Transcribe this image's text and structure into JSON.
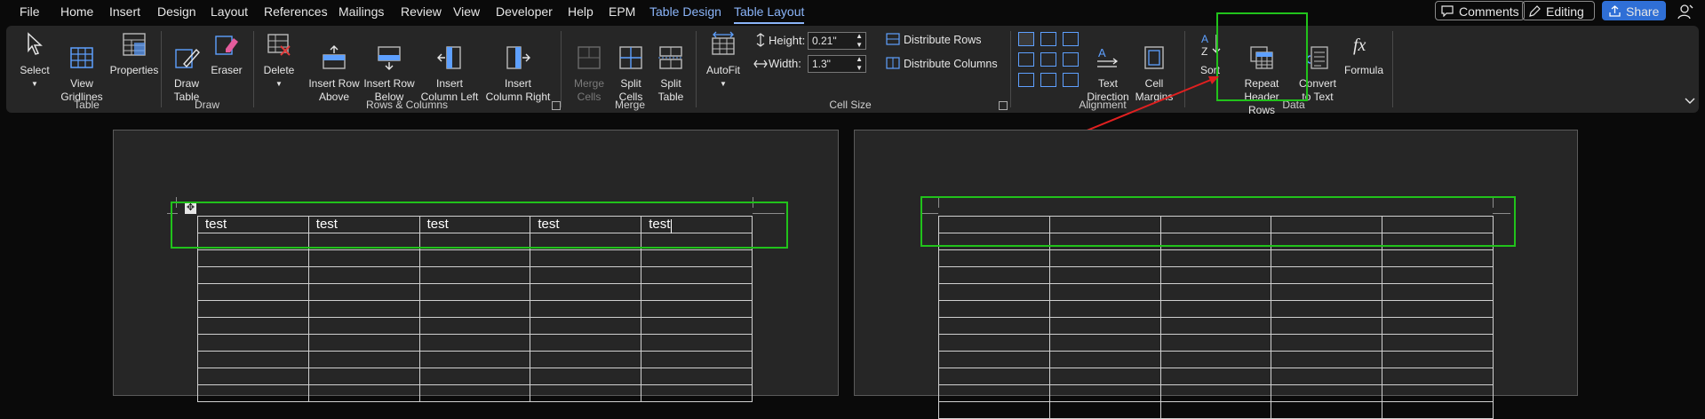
{
  "menu": {
    "tabs": [
      "File",
      "Home",
      "Insert",
      "Design",
      "Layout",
      "References",
      "Mailings",
      "Review",
      "View",
      "Developer",
      "Help",
      "EPM",
      "Table Design",
      "Table Layout"
    ],
    "comments": "Comments",
    "editing": "Editing",
    "share": "Share"
  },
  "ribbon": {
    "table": {
      "select": "Select",
      "view_gridlines": "View\nGridlines",
      "properties": "Properties",
      "group": "Table"
    },
    "draw": {
      "draw_table": "Draw\nTable",
      "eraser": "Eraser",
      "group": "Draw"
    },
    "rows_columns": {
      "delete": "Delete",
      "insert_above": "Insert Row\nAbove",
      "insert_below": "Insert Row\nBelow",
      "insert_left": "Insert\nColumn Left",
      "insert_right": "Insert\nColumn Right",
      "group": "Rows & Columns"
    },
    "merge": {
      "merge_cells": "Merge\nCells",
      "split_cells": "Split\nCells",
      "split_table": "Split\nTable",
      "group": "Merge"
    },
    "cell_size": {
      "autofit": "AutoFit",
      "height_label": "Height:",
      "height_value": "0.21\"",
      "width_label": "Width:",
      "width_value": "1.3\"",
      "distribute_rows": "Distribute Rows",
      "distribute_columns": "Distribute Columns",
      "group": "Cell Size"
    },
    "alignment": {
      "text_direction": "Text\nDirection",
      "cell_margins": "Cell\nMargins",
      "group": "Alignment"
    },
    "data": {
      "sort": "Sort",
      "repeat_header_rows": "Repeat\nHeader Rows",
      "convert_to_text": "Convert\nto Text",
      "formula": "Formula",
      "group": "Data"
    }
  },
  "document": {
    "header_cells": [
      "test",
      "test",
      "test",
      "test",
      "test"
    ]
  },
  "colors": {
    "highlight": "#21c21b",
    "arrow": "#e02020",
    "accent": "#8ab4f8"
  }
}
